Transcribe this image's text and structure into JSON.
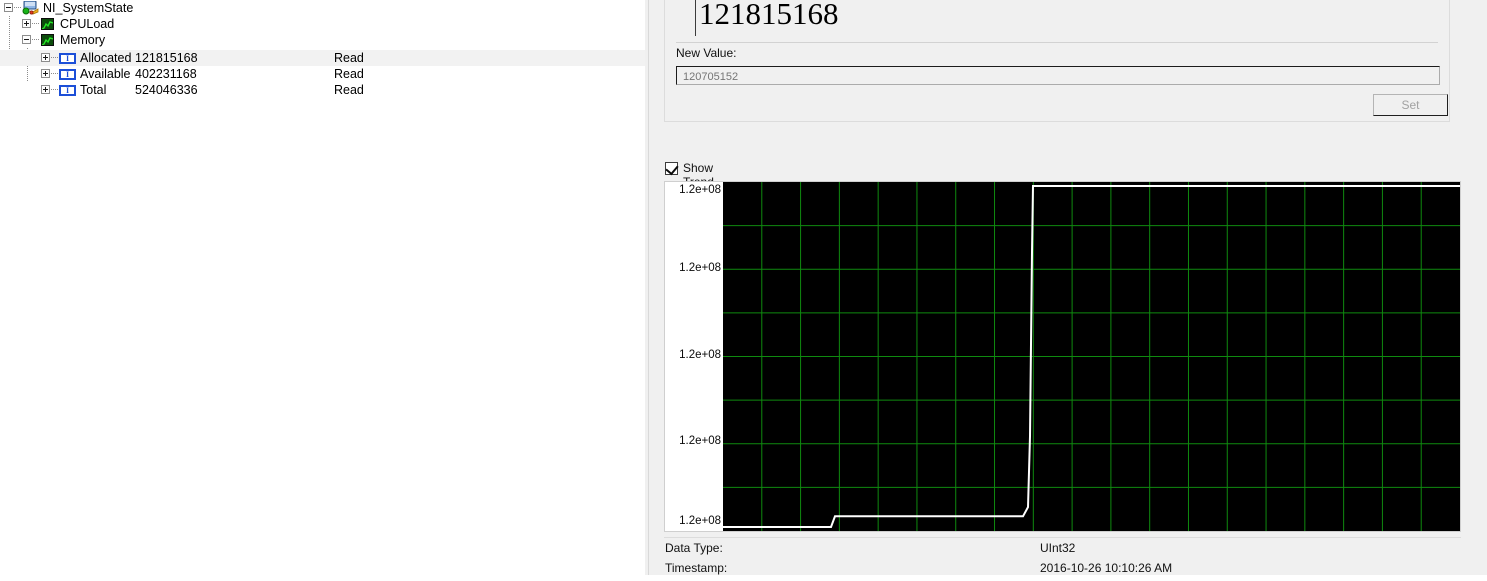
{
  "tree": {
    "root": {
      "label": "NI_SystemState",
      "icon": "server-icon"
    },
    "children": [
      {
        "label": "CPULoad",
        "icon": "waveform-icon",
        "expanded": false,
        "value": "",
        "access": ""
      },
      {
        "label": "Memory",
        "icon": "waveform-icon",
        "expanded": true,
        "value": "",
        "access": ""
      }
    ],
    "memory_items": [
      {
        "label": "Allocated",
        "value": "121815168",
        "access": "Read",
        "icon": "integer-icon",
        "selected": true
      },
      {
        "label": "Available",
        "value": "402231168",
        "access": "Read",
        "icon": "integer-icon",
        "selected": false
      },
      {
        "label": "Total",
        "value": "524046336",
        "access": "Read",
        "icon": "integer-icon",
        "selected": false
      }
    ],
    "integer_icon_glyph": "I"
  },
  "detail": {
    "current_value": "121815168",
    "new_value_label": "New Value:",
    "new_value_placeholder": "120705152",
    "set_label": "Set",
    "show_trend_label": "Show Trend",
    "show_trend_checked": true,
    "data_type_label": "Data Type:",
    "data_type_value": "UInt32",
    "timestamp_label": "Timestamp:",
    "timestamp_value": "2016-10-26 10:10:26 AM"
  },
  "colors": {
    "plot_background": "#000000",
    "grid": "#0f8a0f",
    "trace": "#ffffff",
    "panel": "#f0f0f0",
    "selection": "#f2f2f2",
    "integer_icon": "#1c4fd8"
  },
  "chart_data": {
    "type": "line",
    "title": "",
    "xlabel": "",
    "ylabel": "",
    "grid": true,
    "legend": "none",
    "yticks": [
      "1.2e+08",
      "1.2e+08",
      "1.2e+08",
      "1.2e+08",
      "1.2e+08"
    ],
    "ylim": [
      120705152,
      121815168
    ],
    "xlim": [
      0,
      737
    ],
    "grid_x_count": 19,
    "grid_y_count": 8,
    "series": [
      {
        "name": "Memory.Allocated",
        "color": "#ffffff",
        "points": [
          [
            0,
            120705152
          ],
          [
            108,
            120705152
          ],
          [
            112,
            120740000
          ],
          [
            200,
            120740000
          ],
          [
            300,
            120740000
          ],
          [
            305,
            120770000
          ],
          [
            307,
            121000000
          ],
          [
            308,
            121300000
          ],
          [
            309,
            121600000
          ],
          [
            310,
            121815168
          ],
          [
            737,
            121815168
          ]
        ]
      }
    ]
  }
}
